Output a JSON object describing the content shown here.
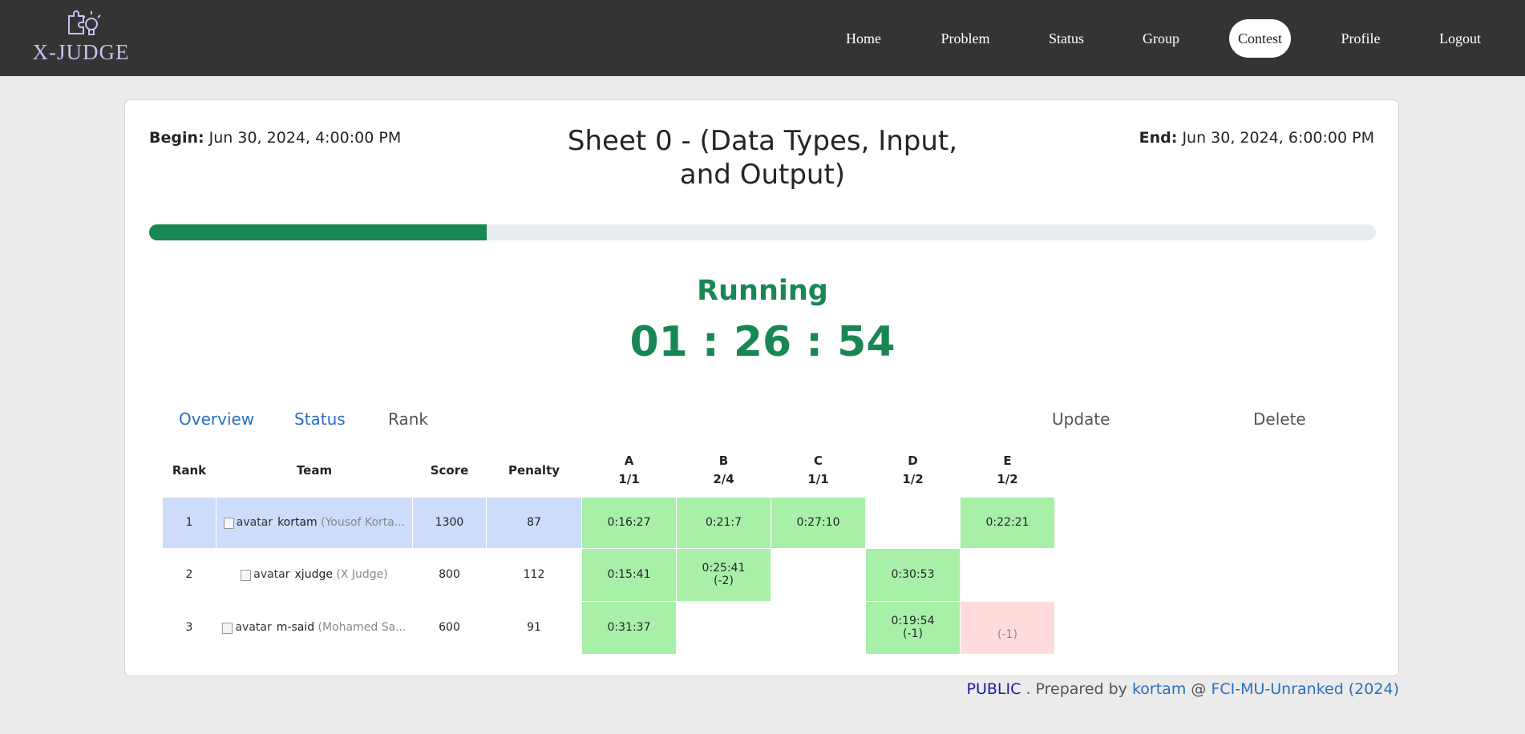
{
  "brand": {
    "name": "X-JUDGE"
  },
  "nav": [
    {
      "label": "Home",
      "active": false
    },
    {
      "label": "Problem",
      "active": false
    },
    {
      "label": "Status",
      "active": false
    },
    {
      "label": "Group",
      "active": false
    },
    {
      "label": "Contest",
      "active": true
    },
    {
      "label": "Profile",
      "active": false
    },
    {
      "label": "Logout",
      "active": false
    }
  ],
  "contest": {
    "begin_label": "Begin:",
    "begin": "Jun 30, 2024, 4:00:00 PM",
    "end_label": "End:",
    "end": "Jun 30, 2024, 6:00:00 PM",
    "title": "Sheet 0 - (Data Types, Input, and Output)",
    "progress_fraction": 0.275,
    "status": "Running",
    "timer": "01 : 26 : 54"
  },
  "tabs": [
    {
      "label": "Overview"
    },
    {
      "label": "Status"
    },
    {
      "label": "Rank"
    }
  ],
  "actions": {
    "update": "Update",
    "delete": "Delete"
  },
  "table": {
    "headers": {
      "rank": "Rank",
      "team": "Team",
      "score": "Score",
      "penalty": "Penalty"
    },
    "problems": [
      {
        "letter": "A",
        "ratio": "1/1"
      },
      {
        "letter": "B",
        "ratio": "2/4"
      },
      {
        "letter": "C",
        "ratio": "1/1"
      },
      {
        "letter": "D",
        "ratio": "1/2"
      },
      {
        "letter": "E",
        "ratio": "1/2"
      }
    ],
    "rows": [
      {
        "rank": "1",
        "avatar_alt": "avatar",
        "handle": "kortam",
        "name": "(Yousof Korta...",
        "score": "1300",
        "penalty": "87",
        "cells": [
          {
            "time": "0:16:27",
            "note": ""
          },
          {
            "time": "0:21:7",
            "note": ""
          },
          {
            "time": "0:27:10",
            "note": ""
          },
          {
            "time": "",
            "note": ""
          },
          {
            "time": "0:22:21",
            "note": ""
          }
        ]
      },
      {
        "rank": "2",
        "avatar_alt": "avatar",
        "handle": "xjudge",
        "name": "(X Judge)",
        "score": "800",
        "penalty": "112",
        "cells": [
          {
            "time": "0:15:41",
            "note": ""
          },
          {
            "time": "0:25:41",
            "note": "(-2)"
          },
          {
            "time": "",
            "note": ""
          },
          {
            "time": "0:30:53",
            "note": ""
          },
          {
            "time": "",
            "note": ""
          }
        ]
      },
      {
        "rank": "3",
        "avatar_alt": "avatar",
        "handle": "m-said",
        "name": "(Mohamed Sa...",
        "score": "600",
        "penalty": "91",
        "cells": [
          {
            "time": "0:31:37",
            "note": ""
          },
          {
            "time": "",
            "note": ""
          },
          {
            "time": "",
            "note": ""
          },
          {
            "time": "0:19:54",
            "note": "(-1)"
          },
          {
            "time": "",
            "note": "(-1)"
          }
        ]
      }
    ]
  },
  "footer": {
    "visibility": "PUBLIC",
    "prepared_by": ". Prepared by",
    "author": "kortam",
    "at": "@",
    "group": "FCI-MU-Unranked (2024)"
  },
  "colors": {
    "navbar": "#343434",
    "success": "#198754",
    "accepted_cell": "#a8f0a8",
    "rejected_cell": "#ffdcdc",
    "highlight_row": "#cddcfa",
    "link": "#2a6fc2"
  }
}
